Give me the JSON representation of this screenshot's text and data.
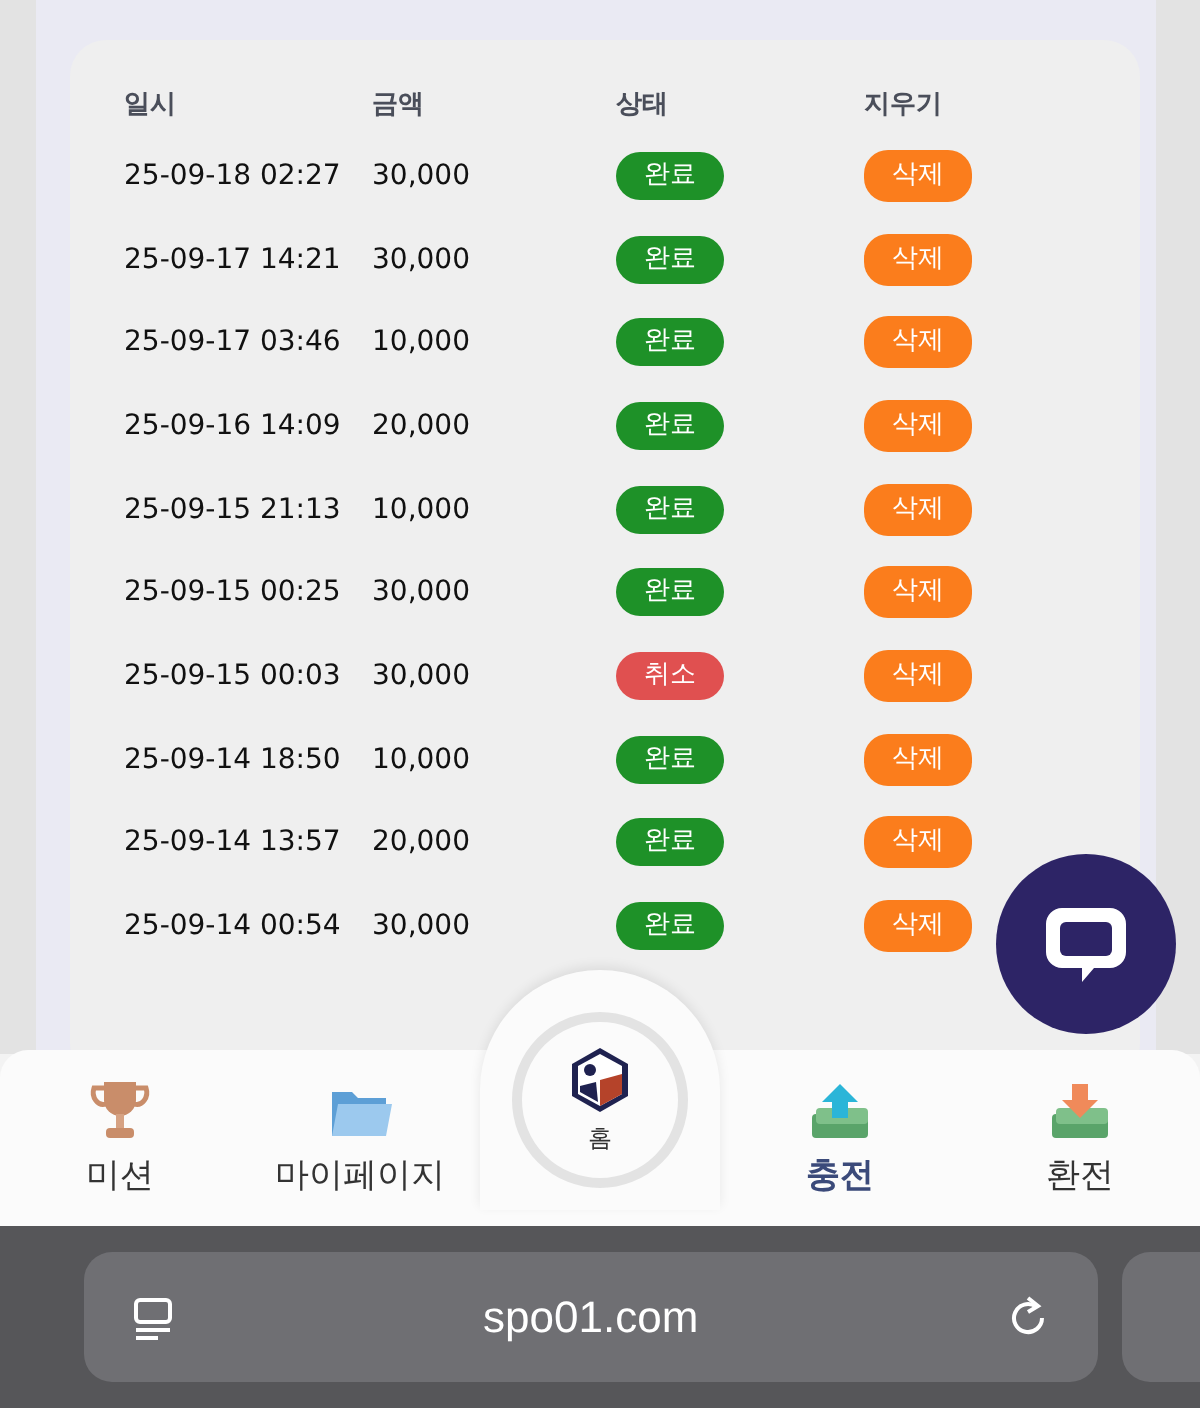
{
  "table": {
    "columns": [
      "일시",
      "금액",
      "상태",
      "지우기"
    ],
    "rows": [
      {
        "date": "25-09-18 02:27",
        "amount": "30,000",
        "status": {
          "kind": "complete",
          "label": "완료"
        },
        "action": "삭제"
      },
      {
        "date": "25-09-17 14:21",
        "amount": "30,000",
        "status": {
          "kind": "complete",
          "label": "완료"
        },
        "action": "삭제"
      },
      {
        "date": "25-09-17 03:46",
        "amount": "10,000",
        "status": {
          "kind": "complete",
          "label": "완료"
        },
        "action": "삭제"
      },
      {
        "date": "25-09-16 14:09",
        "amount": "20,000",
        "status": {
          "kind": "complete",
          "label": "완료"
        },
        "action": "삭제"
      },
      {
        "date": "25-09-15 21:13",
        "amount": "10,000",
        "status": {
          "kind": "complete",
          "label": "완료"
        },
        "action": "삭제"
      },
      {
        "date": "25-09-15 00:25",
        "amount": "30,000",
        "status": {
          "kind": "complete",
          "label": "완료"
        },
        "action": "삭제"
      },
      {
        "date": "25-09-15 00:03",
        "amount": "30,000",
        "status": {
          "kind": "canceled",
          "label": "취소"
        },
        "action": "삭제"
      },
      {
        "date": "25-09-14 18:50",
        "amount": "10,000",
        "status": {
          "kind": "complete",
          "label": "완료"
        },
        "action": "삭제"
      },
      {
        "date": "25-09-14 13:57",
        "amount": "20,000",
        "status": {
          "kind": "complete",
          "label": "완료"
        },
        "action": "삭제"
      },
      {
        "date": "25-09-14 00:54",
        "amount": "30,000",
        "status": {
          "kind": "complete",
          "label": "완료"
        },
        "action": "삭제"
      }
    ]
  },
  "bottom_nav": [
    {
      "kind": "trophy",
      "label": "미션",
      "selected": false
    },
    {
      "kind": "folder",
      "label": "마이페이지",
      "selected": false
    },
    {
      "kind": "home",
      "label": "홈",
      "selected": false
    },
    {
      "kind": "deposit",
      "label": "충전",
      "selected": true
    },
    {
      "kind": "withdraw",
      "label": "환전",
      "selected": false
    }
  ],
  "browser": {
    "url": "spo01.com"
  }
}
